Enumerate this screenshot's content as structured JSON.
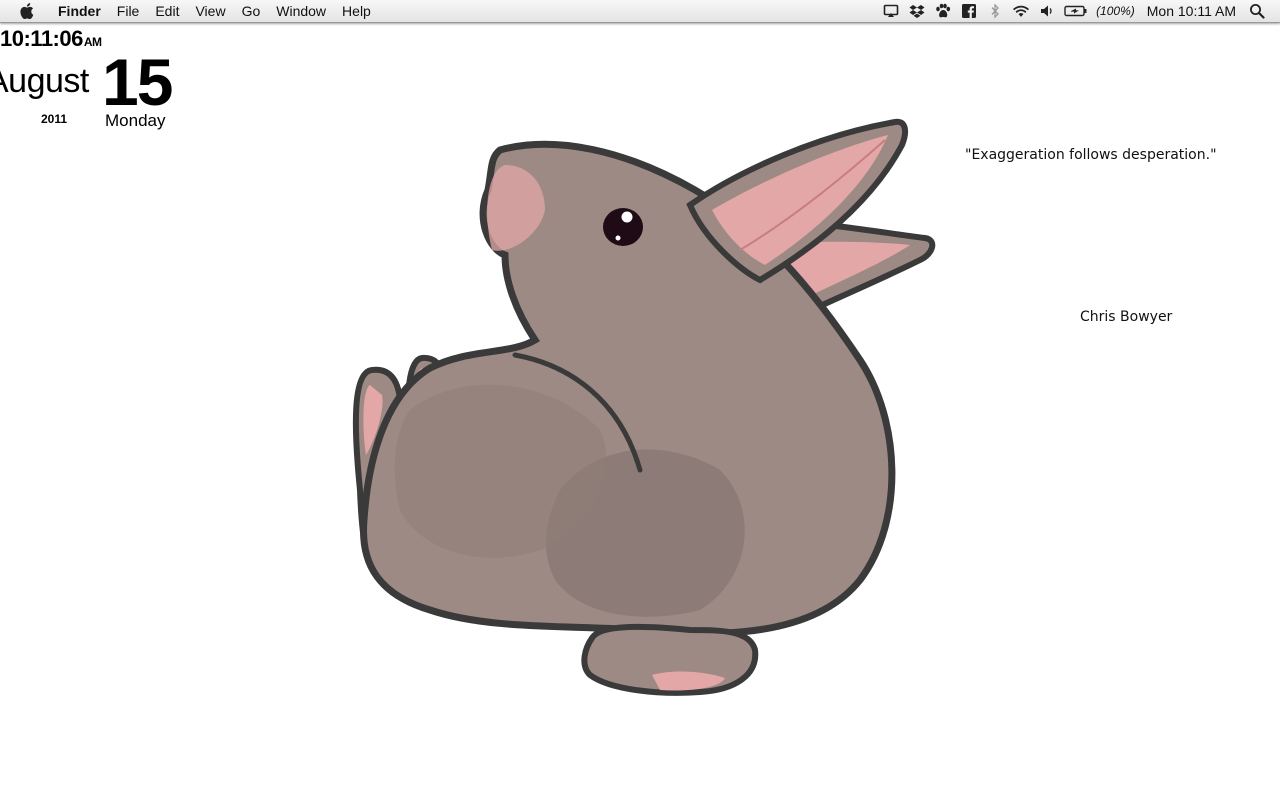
{
  "menubar": {
    "app_name": "Finder",
    "menus": [
      "File",
      "Edit",
      "View",
      "Go",
      "Window",
      "Help"
    ],
    "tray_icons": [
      "airplay-icon",
      "dropbox-icon",
      "paw-icon",
      "facebook-icon",
      "bluetooth-icon",
      "wifi-icon",
      "volume-icon",
      "battery-icon"
    ],
    "battery_percent": "(100%)",
    "clock": "Mon 10:11 AM"
  },
  "desktop_widget": {
    "time": "10:11:06",
    "ampm": "AM",
    "month": "August",
    "day": "15",
    "year": "2011",
    "weekday": "Monday"
  },
  "wallpaper": {
    "quote": "\"Exaggeration follows desperation.\"",
    "author": "Chris Bowyer",
    "colors": {
      "outline": "#3a3a3a",
      "fur": "#9d8a84",
      "fur_dark": "#857570",
      "ear_pink": "#e3a7a7",
      "eye": "#1e0b16"
    }
  }
}
